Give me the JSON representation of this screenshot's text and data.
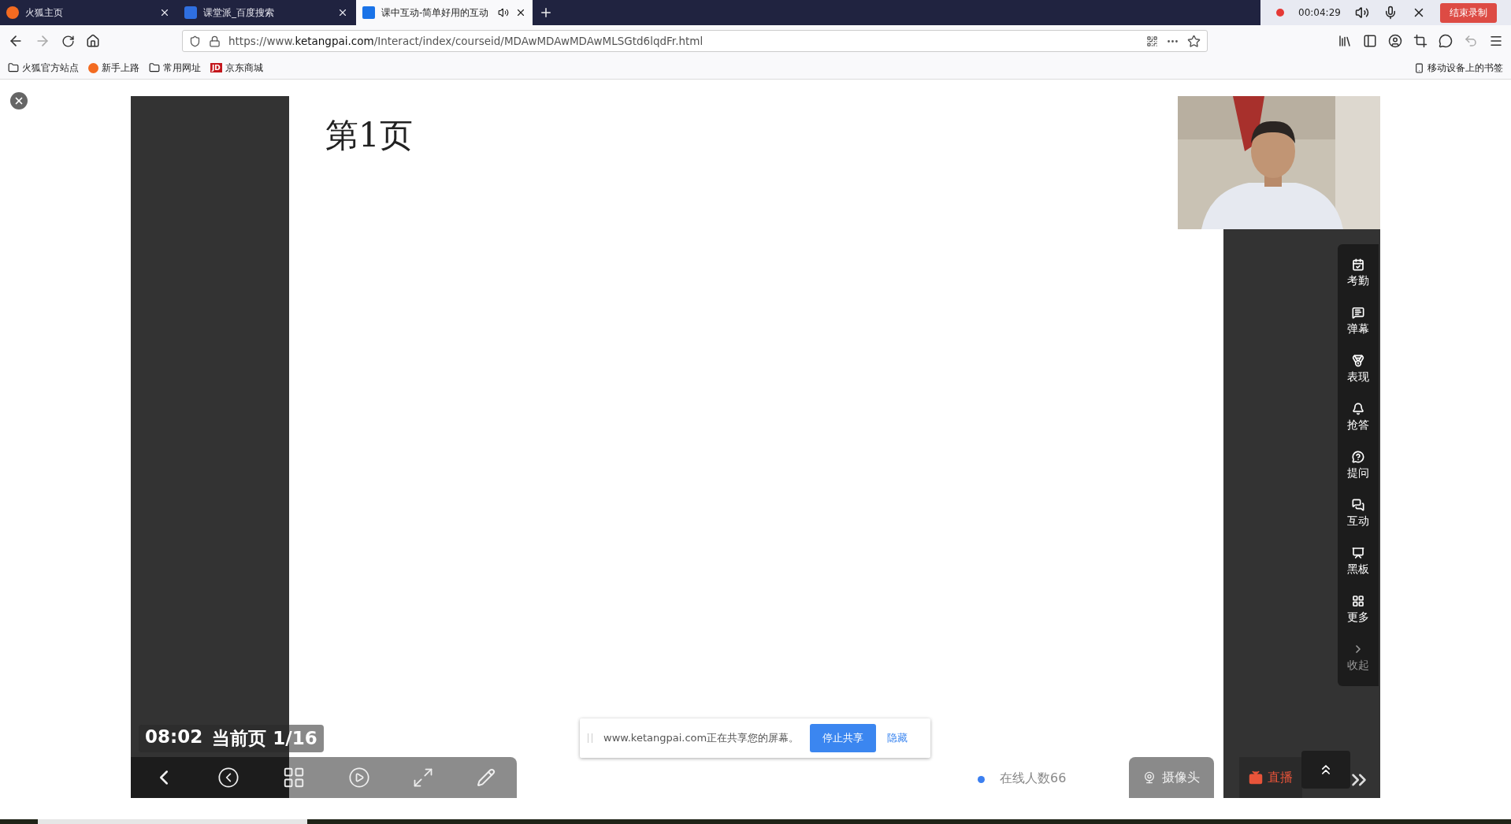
{
  "tabs": [
    {
      "title": "火狐主页",
      "kind": "firefox",
      "selected": false,
      "audio": false
    },
    {
      "title": "课堂派_百度搜索",
      "kind": "baidu",
      "selected": false,
      "audio": false
    },
    {
      "title": "课中互动-简单好用的互动",
      "kind": "ketangpai",
      "selected": true,
      "audio": true
    }
  ],
  "recorder": {
    "time": "00:04:29",
    "stop_label": "结束录制"
  },
  "address": {
    "prefix": "https://www.",
    "domain": "ketangpai.com",
    "path": "/Interact/index/courseid/MDAwMDAwMDAwMLSGtd6lqdFr.html"
  },
  "bookmarks": [
    {
      "label": "火狐官方站点",
      "kind": "folder"
    },
    {
      "label": "新手上路",
      "kind": "firefox"
    },
    {
      "label": "常用网址",
      "kind": "folder"
    },
    {
      "label": "京东商城",
      "kind": "jd",
      "badge": "JD"
    }
  ],
  "mobile_bookmarks": "移动设备上的书签",
  "slide": {
    "title": "第1页"
  },
  "side_menu": [
    {
      "label": "考勤",
      "kind": "attendance"
    },
    {
      "label": "弹幕",
      "kind": "danmaku"
    },
    {
      "label": "表现",
      "kind": "medal"
    },
    {
      "label": "抢答",
      "kind": "bell"
    },
    {
      "label": "提问",
      "kind": "question"
    },
    {
      "label": "互动",
      "kind": "chat"
    },
    {
      "label": "黑板",
      "kind": "board"
    },
    {
      "label": "更多",
      "kind": "more"
    },
    {
      "label": "收起",
      "kind": "collapse"
    }
  ],
  "page_info": {
    "time": "08:02",
    "label": "当前页 1/16"
  },
  "share_bar": {
    "message": "www.ketangpai.com正在共享您的屏幕。",
    "stop": "停止共享",
    "hide": "隐藏"
  },
  "online": "在线人数66",
  "camera": "摄像头",
  "live": "直播"
}
